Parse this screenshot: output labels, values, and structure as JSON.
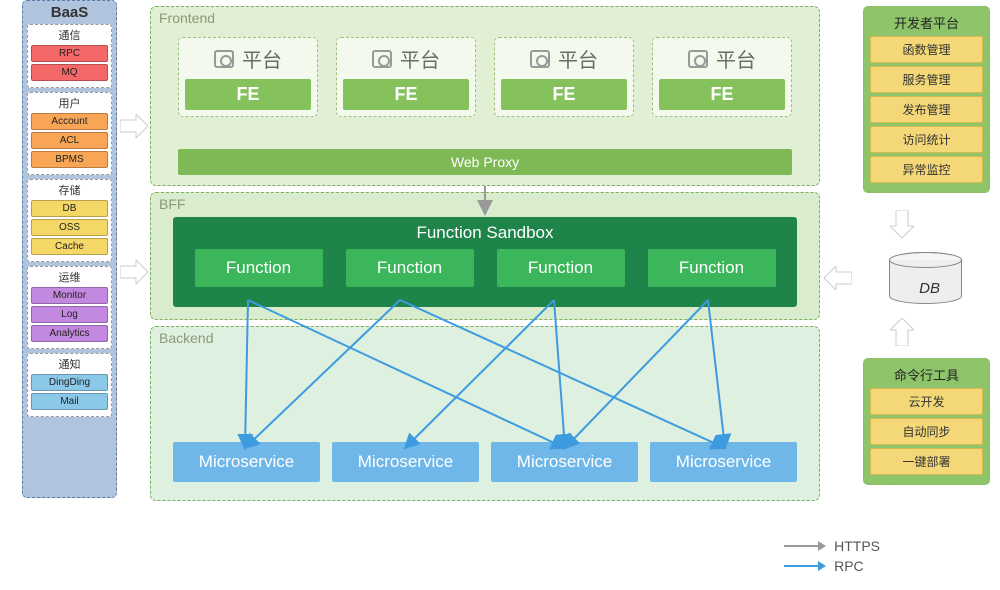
{
  "baas": {
    "title": "BaaS",
    "groups": [
      {
        "title": "通信",
        "style": "sty-red",
        "items": [
          "RPC",
          "MQ"
        ]
      },
      {
        "title": "用户",
        "style": "sty-orange",
        "items": [
          "Account",
          "ACL",
          "BPMS"
        ]
      },
      {
        "title": "存储",
        "style": "sty-yellow",
        "items": [
          "DB",
          "OSS",
          "Cache"
        ]
      },
      {
        "title": "运维",
        "style": "sty-purple",
        "items": [
          "Monitor",
          "Log",
          "Analytics"
        ]
      },
      {
        "title": "通知",
        "style": "sty-blue",
        "items": [
          "DingDing",
          "Mail"
        ]
      }
    ]
  },
  "tiers": {
    "frontend": {
      "label": "Frontend",
      "platformLabel": "平台",
      "feLabel": "FE",
      "webproxy": "Web Proxy"
    },
    "bff": {
      "label": "BFF",
      "sandbox": "Function Sandbox",
      "fnLabel": "Function"
    },
    "backend": {
      "label": "Backend",
      "msLabel": "Microservice"
    }
  },
  "devPanel": {
    "title": "开发者平台",
    "items": [
      "函数管理",
      "服务管理",
      "发布管理",
      "访问统计",
      "异常监控"
    ]
  },
  "cliPanel": {
    "title": "命令行工具",
    "items": [
      "云开发",
      "自动同步",
      "一键部署"
    ]
  },
  "db": {
    "label": "DB"
  },
  "legend": {
    "https": "HTTPS",
    "rpc": "RPC"
  },
  "chart_data": {
    "type": "diagram",
    "title": "Serverless / FaaS architecture",
    "nodes": {
      "baas_sidebar": {
        "label": "BaaS",
        "children": [
          "通信",
          "用户",
          "存储",
          "运维",
          "通知"
        ]
      },
      "frontend": {
        "label": "Frontend",
        "children": [
          "平台×4 → FE",
          "Web Proxy"
        ]
      },
      "bff": {
        "label": "BFF",
        "children": [
          "Function Sandbox",
          "Function×4"
        ]
      },
      "backend": {
        "label": "Backend",
        "children": [
          "Microservice×4"
        ]
      },
      "dev_platform": {
        "label": "开发者平台",
        "children": [
          "函数管理",
          "服务管理",
          "发布管理",
          "访问统计",
          "异常监控"
        ]
      },
      "cli_tools": {
        "label": "命令行工具",
        "children": [
          "云开发",
          "自动同步",
          "一键部署"
        ]
      },
      "db": {
        "label": "DB"
      }
    },
    "edges": [
      {
        "from": "BaaS",
        "to": "Frontend",
        "type": "block-arrow"
      },
      {
        "from": "BaaS",
        "to": "BFF",
        "type": "block-arrow"
      },
      {
        "from": "Web Proxy",
        "to": "Function Sandbox",
        "type": "HTTPS"
      },
      {
        "from": "Function[0]",
        "to": "Microservice[0]",
        "type": "RPC"
      },
      {
        "from": "Function[0]",
        "to": "Microservice[2]",
        "type": "RPC"
      },
      {
        "from": "Function[1]",
        "to": "Microservice[0]",
        "type": "RPC"
      },
      {
        "from": "Function[1]",
        "to": "Microservice[3]",
        "type": "RPC"
      },
      {
        "from": "Function[2]",
        "to": "Microservice[1]",
        "type": "RPC"
      },
      {
        "from": "Function[2]",
        "to": "Microservice[2]",
        "type": "RPC"
      },
      {
        "from": "Function[3]",
        "to": "Microservice[2]",
        "type": "RPC"
      },
      {
        "from": "Function[3]",
        "to": "Microservice[3]",
        "type": "RPC"
      },
      {
        "from": "开发者平台",
        "to": "DB",
        "type": "block-arrow"
      },
      {
        "from": "DB",
        "to": "Function Sandbox",
        "type": "block-arrow"
      },
      {
        "from": "命令行工具",
        "to": "DB",
        "type": "block-arrow"
      }
    ],
    "legend": [
      {
        "style": "grey-arrow",
        "label": "HTTPS"
      },
      {
        "style": "blue-arrow",
        "label": "RPC"
      }
    ]
  }
}
